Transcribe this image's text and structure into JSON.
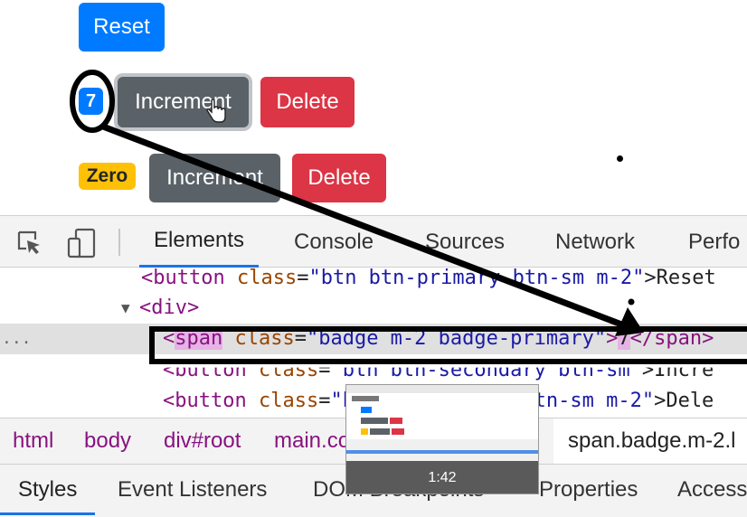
{
  "app": {
    "reset_label": "Reset",
    "counters": [
      {
        "badge": "7",
        "increment_label": "Increment",
        "delete_label": "Delete"
      },
      {
        "badge": "Zero",
        "increment_label": "Increment",
        "delete_label": "Delete"
      }
    ]
  },
  "devtools": {
    "tabs": [
      "Elements",
      "Console",
      "Sources",
      "Network",
      "Perfo"
    ],
    "active_tab": "Elements",
    "code": {
      "line1": {
        "open": "<button ",
        "attr": "class",
        "eq": "=",
        "val": "\"btn btn-primary btn-sm m-2\"",
        "close": ">Reset"
      },
      "line2": {
        "arrow": "▼",
        "tag": "<div>"
      },
      "line3": {
        "dots": "...",
        "lt": "<",
        "tag": "span",
        "attr": " class",
        "eq": "=",
        "val": "\"badge m-2 badge-primary\"",
        "gt": ">",
        "content": "7",
        "close": "</span>"
      },
      "line4": {
        "open": "<button ",
        "attr": "class",
        "eq": "=",
        "val": "\"btn btn-secondary btn-sm\"",
        "close": ">Incre"
      },
      "line5": {
        "open": "<button ",
        "attr": "class",
        "eq": "=",
        "val": "\"btn btn-danger btn-sm m-2\"",
        "close": ">Dele"
      }
    },
    "breadcrumbs": [
      "html",
      "body",
      "div#root",
      "main.co"
    ],
    "current_crumb": "span.badge.m-2.l",
    "subtabs": [
      "Styles",
      "Event Listeners",
      "DOM Breakpoints",
      "Properties",
      "Access"
    ],
    "active_subtab": "Styles"
  },
  "thumbnail": {
    "time": "1:42"
  },
  "colors": {
    "primary": "#007bff",
    "secondary": "#5a6268",
    "danger": "#dc3545",
    "warning": "#ffc107",
    "devtools_accent": "#1a73e8"
  }
}
